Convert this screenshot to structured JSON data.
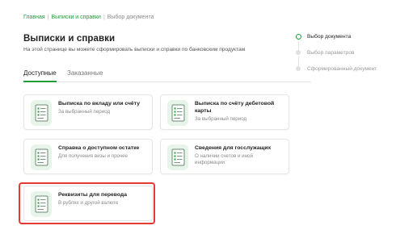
{
  "breadcrumb": {
    "home": "Главная",
    "section": "Выписки и справки",
    "current": "Выбор документа"
  },
  "page": {
    "title": "Выписки и справки",
    "subtitle": "На этой странице вы можете сформировать выписки и справки по банковским продуктам"
  },
  "tabs": [
    {
      "label": "Доступные",
      "active": true
    },
    {
      "label": "Заказанные",
      "active": false
    }
  ],
  "cards": [
    {
      "title": "Выписка по вкладу или счёту",
      "desc": "За выбранный период",
      "icon": "document-list-icon"
    },
    {
      "title": "Выписка по счёту дебетовой карты",
      "desc": "За выбранный период",
      "icon": "document-list-icon"
    },
    {
      "title": "Справка о доступном остатке",
      "desc": "Для получения визы и прочее",
      "icon": "document-list-icon"
    },
    {
      "title": "Сведения для госслужащих",
      "desc": "О наличии счетов и иной информации",
      "icon": "document-list-icon"
    },
    {
      "title": "Реквизиты для перевода",
      "desc": "В рублях и другой валюте",
      "icon": "document-list-icon"
    }
  ],
  "stepper": [
    {
      "label": "Выбор документа",
      "active": true
    },
    {
      "label": "Выбор параметров",
      "active": false
    },
    {
      "label": "Сформированный документ",
      "active": false
    }
  ],
  "colors": {
    "accent": "#21a038",
    "highlight": "#e53935"
  }
}
